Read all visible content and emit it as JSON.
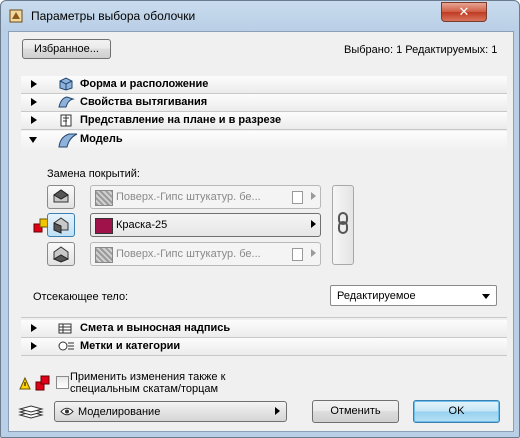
{
  "window": {
    "title": "Параметры выбора оболочки",
    "close_label": "✕"
  },
  "header": {
    "favorites_label": "Избранное...",
    "selection_status": "Выбрано: 1 Редактируемых: 1"
  },
  "sections": {
    "form": {
      "label": "Форма и расположение",
      "icon": "box-shape-icon"
    },
    "extrusion": {
      "label": "Свойства вытягивания",
      "icon": "extrusion-icon"
    },
    "plan": {
      "label": "Представление на плане и в разрезе",
      "icon": "plan-section-icon"
    },
    "model": {
      "label": "Модель",
      "icon": "shell-model-icon",
      "expanded": true
    },
    "schedule": {
      "label": "Смета и выносная надпись",
      "icon": "schedule-icon"
    },
    "tags": {
      "label": "Метки и категории",
      "icon": "tags-icon"
    }
  },
  "model": {
    "override_label": "Замена покрытий:",
    "surfaces": [
      {
        "name": "Поверх.-Гипс штукатур. бе...",
        "state": "disabled",
        "swatch": "#a8a8a8"
      },
      {
        "name": "Краска-25",
        "state": "active",
        "swatch": "#a0134a"
      },
      {
        "name": "Поверх.-Гипс штукатур. бе...",
        "state": "disabled",
        "swatch": "#a8a8a8"
      }
    ],
    "cut_body_label": "Отсекающее тело:",
    "cut_body_value": "Редактируемое"
  },
  "footer": {
    "apply_text": "Применить изменения также к специальным скатам/торцам",
    "view_label": "Моделирование",
    "cancel_label": "Отменить",
    "ok_label": "OK"
  },
  "colors": {
    "accent": "#3c7fb1",
    "paint": "#a0134a",
    "titlebar": "#b9cfe6",
    "close": "#c03a22"
  }
}
